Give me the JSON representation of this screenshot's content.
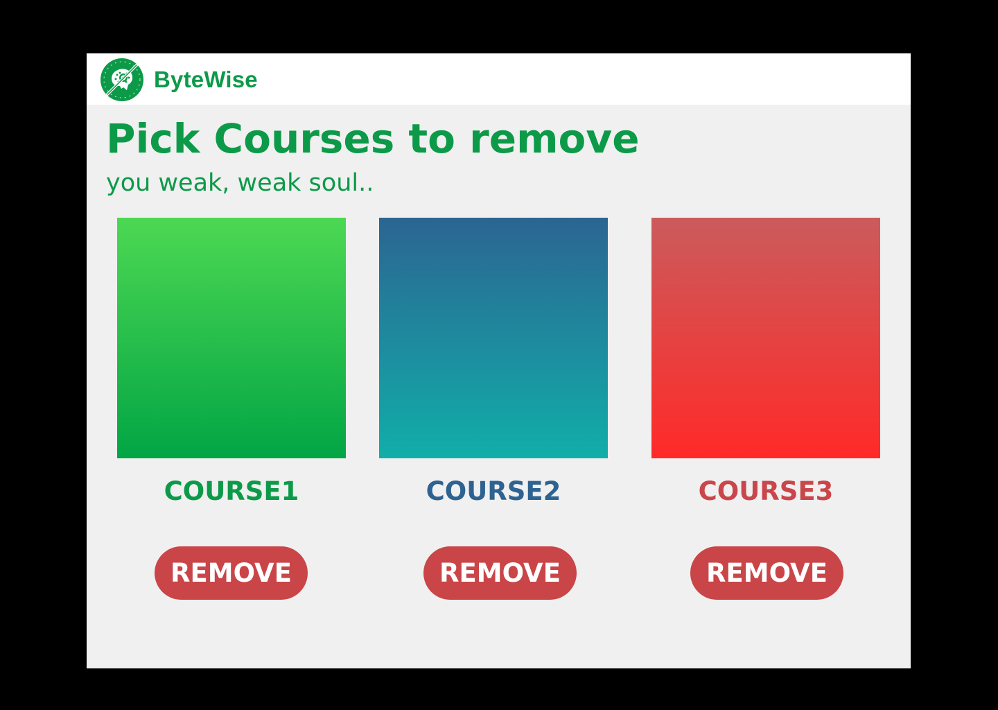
{
  "header": {
    "brand_name": "ByteWise",
    "logo_icon": "brain-circuit-logo-icon"
  },
  "main": {
    "title": "Pick Courses to remove",
    "subtitle": "you weak, weak soul..",
    "courses": [
      {
        "name": "COURSE1",
        "remove_label": "REMOVE",
        "gradient_top": "#4dd853",
        "gradient_bottom": "#02a545",
        "name_color": "#0c9a49"
      },
      {
        "name": "COURSE2",
        "remove_label": "REMOVE",
        "gradient_top": "#2b6592",
        "gradient_bottom": "#11aea9",
        "name_color": "#2d6291"
      },
      {
        "name": "COURSE3",
        "remove_label": "REMOVE",
        "gradient_top": "#cb5b5c",
        "gradient_bottom": "#ff2a28",
        "name_color": "#c9464a"
      }
    ]
  },
  "colors": {
    "brand_green": "#0c9a49",
    "button_red": "#c94548",
    "page_background": "#f0f0f0",
    "outer_background": "#000000"
  }
}
